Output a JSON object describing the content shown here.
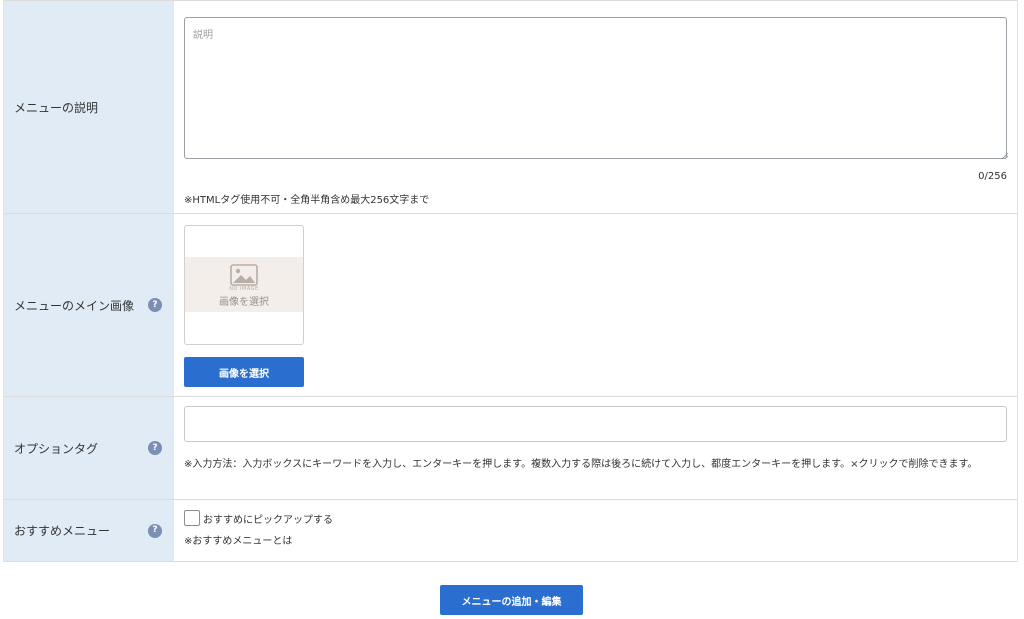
{
  "fields": {
    "description": {
      "label": "メニューの説明",
      "placeholder": "説明",
      "value": "",
      "counter": "0/256",
      "note": "※HTMLタグ使用不可・全角半角含め最大256文字まで"
    },
    "main_image": {
      "label": "メニューのメイン画像",
      "help": "?",
      "noimage_text": "NO IMAGE",
      "placeholder_caption": "画像を選択",
      "select_button": "画像を選択"
    },
    "option_tag": {
      "label": "オプションタグ",
      "help": "?",
      "value": "",
      "note": "※入力方法：入力ボックスにキーワードを入力し、エンターキーを押します。複数入力する際は後ろに続けて入力し、都度エンターキーを押します。×クリックで削除できます。"
    },
    "recommended": {
      "label": "おすすめメニュー",
      "help": "?",
      "checkbox_label": "おすすめにピックアップする",
      "checked": false,
      "note": "※おすすめメニューとは"
    }
  },
  "submit_button": "メニューの追加・編集",
  "colors": {
    "label_bg": "#e1ebf5",
    "primary": "#2a6fcf",
    "help_icon": "#7b8fb5"
  }
}
